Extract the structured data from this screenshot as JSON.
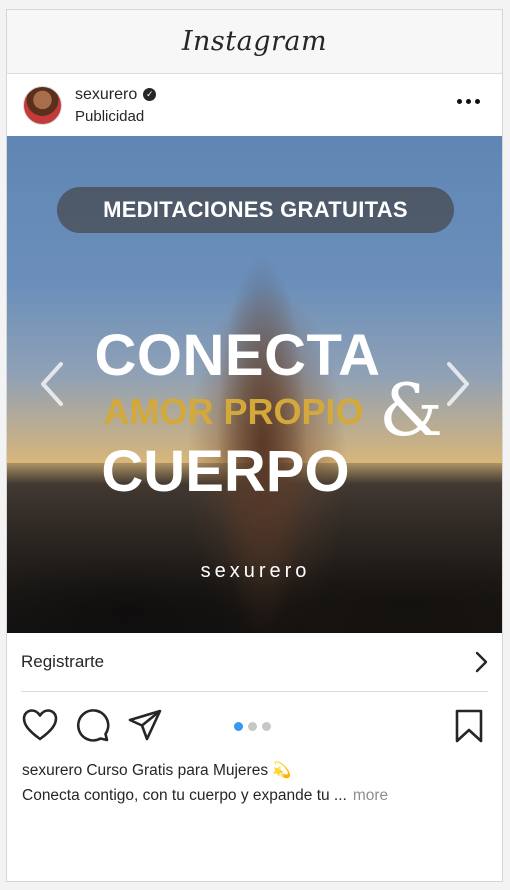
{
  "app": {
    "title": "Instagram"
  },
  "post": {
    "username": "sexurero",
    "sponsored_label": "Publicidad"
  },
  "media": {
    "pill_text": "MEDITACIONES GRATUITAS",
    "line1": "CONECTA",
    "line2": "AMOR PROPIO",
    "ampersand": "&",
    "line3": "CUERPO",
    "watermark": "sexurero"
  },
  "cta": {
    "label": "Registrarte"
  },
  "carousel": {
    "current_index": 1,
    "total": 3
  },
  "caption": {
    "handle": "sexurero",
    "title": "Curso Gratis para Mujeres 💫",
    "body": "Conecta contigo, con tu cuerpo y expande tu ...",
    "more_label": "more"
  },
  "colors": {
    "accent_gold": "#d4a93a",
    "dot_active": "#3897f0",
    "dot_inactive": "#c7c7c7"
  },
  "icons": [
    "verified-icon",
    "more-options-icon",
    "chevron-left-icon",
    "chevron-right-icon",
    "heart-icon",
    "comment-icon",
    "share-icon",
    "bookmark-icon"
  ]
}
